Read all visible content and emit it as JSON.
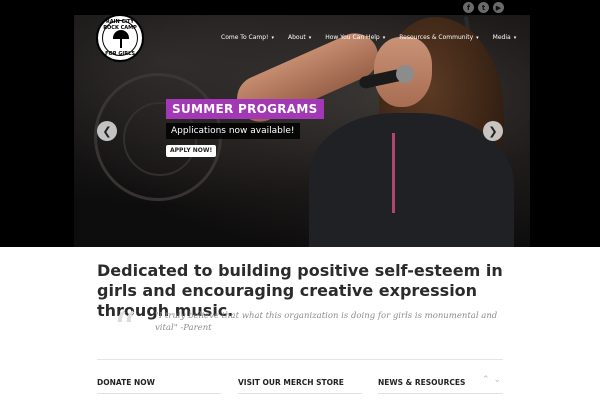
{
  "social": {
    "icons": [
      "facebook-icon",
      "twitter-icon",
      "youtube-icon"
    ],
    "glyphs": [
      "f",
      "t",
      "▶"
    ]
  },
  "logo": {
    "text_top": "RAIN CITY ROCK CAMP",
    "text_bottom": "FOR GIRLS"
  },
  "nav": {
    "items": [
      {
        "label": "Come To Camp!"
      },
      {
        "label": "About"
      },
      {
        "label": "How You Can Help"
      },
      {
        "label": "Resources & Community"
      },
      {
        "label": "Media"
      }
    ],
    "caret": "▾"
  },
  "slider": {
    "title": "SUMMER PROGRAMS",
    "subtitle": "Applications now available!",
    "button": "APPLY NOW!",
    "prev": "❮",
    "next": "❯"
  },
  "main": {
    "tagline": "Dedicated to building positive self-esteem in girls and encouraging creative expression through music.",
    "quote_mark": "“",
    "quote": "\"I truly believe that what this organization is doing for girls is monumental and vital\" -Parent"
  },
  "sections": {
    "donate": "DONATE NOW",
    "merch": "VISIT OUR MERCH STORE",
    "news": "NEWS & RESOURCES",
    "up": "⌃",
    "down": "⌄"
  },
  "colors": {
    "accent_purple": "#a338b6",
    "background": "#000000",
    "text_dark": "#2b2b2b"
  }
}
